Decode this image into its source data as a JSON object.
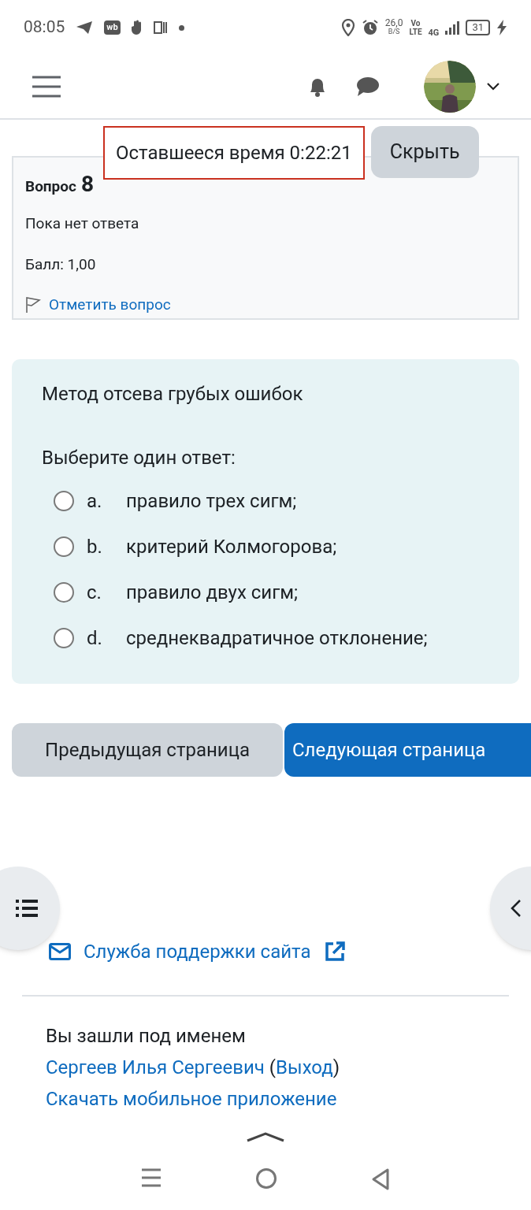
{
  "status_bar": {
    "time": "08:05",
    "app_badge": "wb",
    "speed_value": "26,0",
    "speed_unit": "B/S",
    "volte_top": "Vo",
    "volte_bottom": "LTE",
    "network": "4G",
    "battery": "31"
  },
  "timer": {
    "text": "Оставшееся время 0:22:21",
    "hide_button": "Скрыть"
  },
  "question_info": {
    "label": "Вопрос",
    "number": "8",
    "status": "Пока нет ответа",
    "grade": "Балл: 1,00",
    "flag_link": "Отметить вопрос",
    "flagged": false
  },
  "question": {
    "text": "Метод отсева грубых ошибок",
    "prompt": "Выберите один ответ:",
    "options": [
      {
        "letter": "a.",
        "text": "правило трех сигм;",
        "selected": false
      },
      {
        "letter": "b.",
        "text": "критерий Колмогорова;",
        "selected": false
      },
      {
        "letter": "c.",
        "text": "правило двух сигм;",
        "selected": false
      },
      {
        "letter": "d.",
        "text": "среднеквадратичное отклонение;",
        "selected": false
      }
    ]
  },
  "navigation": {
    "previous": "Предыдущая страница",
    "next": "Следующая страница"
  },
  "footer": {
    "support_link": "Служба поддержки сайта",
    "logged_in_text": "Вы зашли под именем ",
    "user_link": "Сергеев Илья Сергеевич",
    "open_paren": " (",
    "logout_link": "Выход",
    "close_paren": ")",
    "app_link": "Скачать мобильное приложение"
  }
}
